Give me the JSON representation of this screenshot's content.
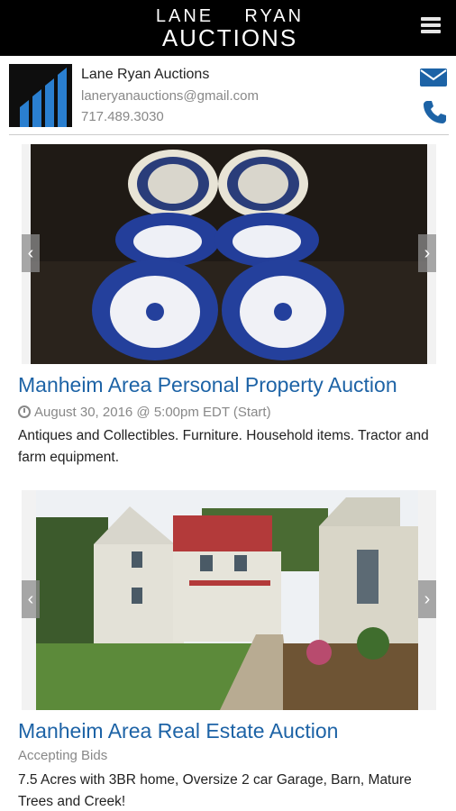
{
  "header": {
    "logo_line1": "LANE    RYAN",
    "logo_line2": "AUCTIONS",
    "menu_icon": "hamburger-icon"
  },
  "contact": {
    "name": "Lane Ryan Auctions",
    "email": "laneryanauctions@gmail.com",
    "phone": "717.489.3030",
    "email_icon": "envelope-icon",
    "phone_icon": "phone-icon",
    "accent_color": "#1d63a6"
  },
  "listings": [
    {
      "title": "Manheim Area Personal Property Auction",
      "meta_icon": "clock-icon",
      "meta": "August 30, 2016 @ 5:00pm EDT (Start)",
      "description": "Antiques and Collectibles. Furniture. Household items. Tractor and farm equipment.",
      "prev_icon": "chevron-left-icon",
      "next_icon": "chevron-right-icon"
    },
    {
      "title": "Manheim Area Real Estate Auction",
      "meta": "Accepting Bids",
      "description": "7.5 Acres with 3BR home, Oversize 2 car Garage, Barn, Mature Trees and Creek!",
      "prev_icon": "chevron-left-icon",
      "next_icon": "chevron-right-icon"
    }
  ]
}
